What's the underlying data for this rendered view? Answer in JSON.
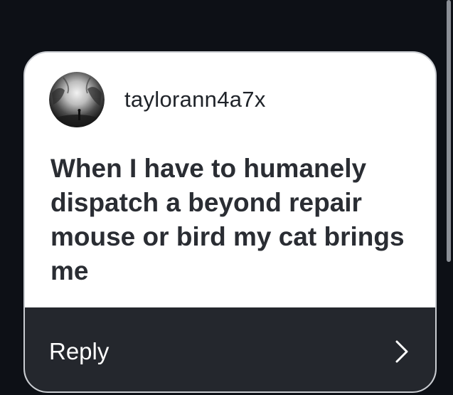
{
  "card": {
    "username": "taylorann4a7x",
    "avatar_icon": "avatar-photo",
    "question": "When I have to humanely dispatch a beyond repair mouse or bird my cat brings me"
  },
  "reply": {
    "label": "Reply",
    "icon": "chevron-right-icon"
  },
  "colors": {
    "background": "#0d1016",
    "card": "#ffffff",
    "reply_bar": "#24272d",
    "text_dark": "#2a2d33"
  }
}
